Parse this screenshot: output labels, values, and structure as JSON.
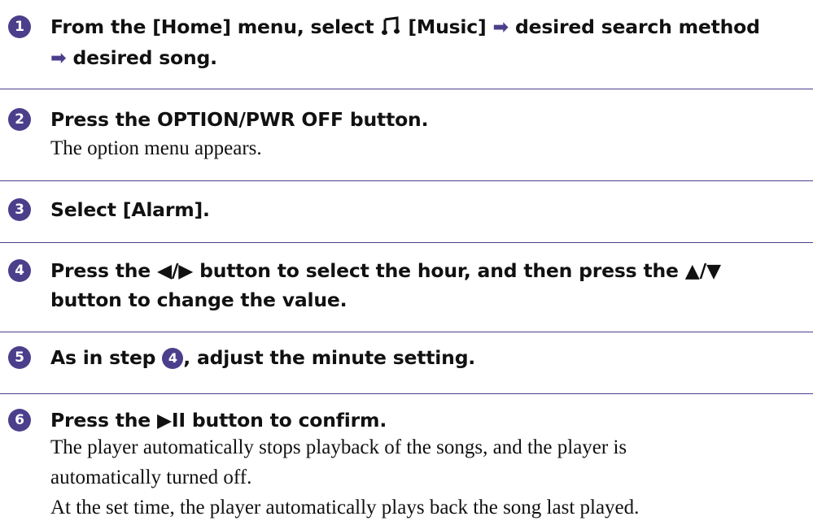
{
  "steps": [
    {
      "number": "1",
      "line1_before_icon": "From the [Home] menu, select ",
      "line1_icon": "music-note-icon",
      "line1_after_icon": " [Music] ",
      "line1_arrow": "➡",
      "line1_end": " desired search method",
      "line2_arrow": "➡",
      "line2_text": " desired song."
    },
    {
      "number": "2",
      "heading": "Press the OPTION/PWR OFF button.",
      "description": "The option menu appears."
    },
    {
      "number": "3",
      "heading": "Select [Alarm]."
    },
    {
      "number": "4",
      "heading_line1": "Press the ◀/▶ button to select the hour, and then press the ▲/▼",
      "heading_line2": "button to change the value."
    },
    {
      "number": "5",
      "heading_before": "As in step ",
      "heading_ref": "4",
      "heading_after": ", adjust the minute setting."
    },
    {
      "number": "6",
      "heading": "Press the ▶II button to confirm.",
      "description_lines": [
        "The player automatically stops playback of the songs, and the player is",
        "automatically turned off.",
        "At the set time, the player automatically plays back the song last played."
      ]
    }
  ],
  "colors": {
    "accent": "#4b3f8c",
    "text": "#111111"
  }
}
